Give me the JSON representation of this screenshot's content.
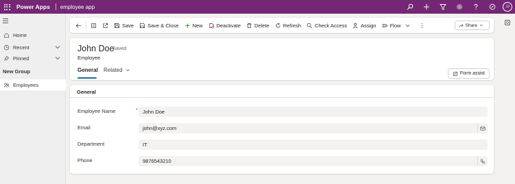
{
  "topbar": {
    "app_name": "Power Apps",
    "environment": "employee app",
    "icons": [
      "search-icon",
      "plus-icon",
      "filter-icon",
      "settings-icon",
      "help-icon",
      "copilot-icon"
    ],
    "avatar_initials": "JJ"
  },
  "sidebar": {
    "items": [
      {
        "label": "Home",
        "icon": "home-icon"
      },
      {
        "label": "Recent",
        "icon": "clock-icon"
      },
      {
        "label": "Pinned",
        "icon": "pin-icon"
      }
    ],
    "group_label": "New Group",
    "group_items": [
      {
        "label": "Employees",
        "icon": "people-icon"
      }
    ]
  },
  "commandbar": {
    "save": "Save",
    "save_close": "Save & Close",
    "new": "New",
    "deactivate": "Deactivate",
    "delete": "Delete",
    "refresh": "Refresh",
    "check_access": "Check Access",
    "assign": "Assign",
    "flow": "Flow",
    "share": "Share"
  },
  "record": {
    "title": "John Doe",
    "status": "- Saved",
    "entity": "Employee",
    "tabs": {
      "general": "General",
      "related": "Related"
    },
    "form_assist": "Form assist"
  },
  "form": {
    "section_title": "General",
    "fields": [
      {
        "label": "Employee Name",
        "value": "John Doe",
        "required": "*"
      },
      {
        "label": "Email",
        "value": "john@xyz.com",
        "action_icon": "mail-icon"
      },
      {
        "label": "Department",
        "value": "IT"
      },
      {
        "label": "Phone",
        "value": "9876543210",
        "action_icon": "phone-icon"
      }
    ]
  },
  "colors": {
    "brand": "#742774",
    "accent": "#0f6cbd",
    "required": "#c50f1f"
  }
}
